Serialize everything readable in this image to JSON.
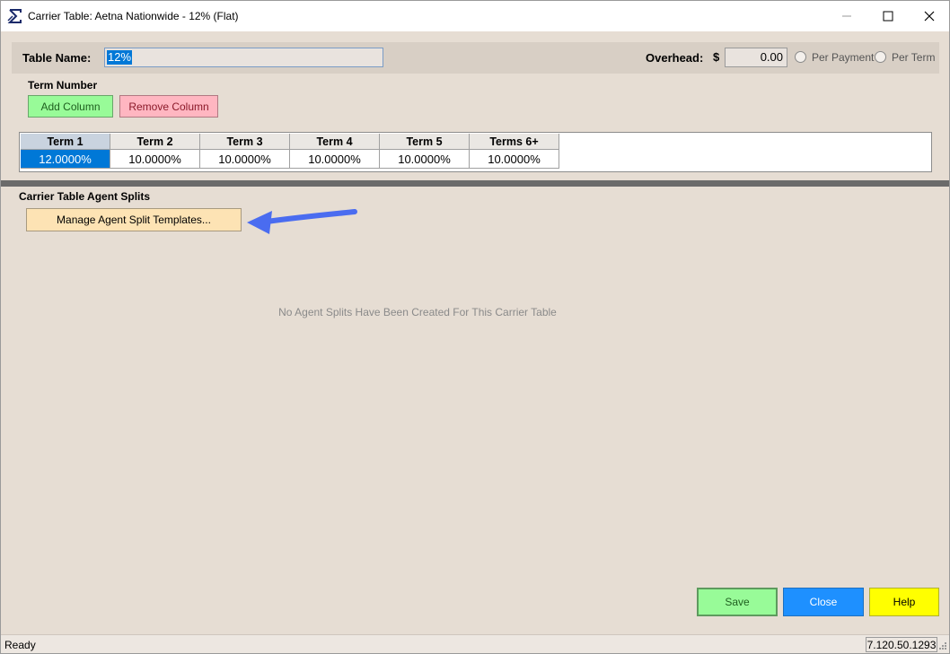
{
  "window": {
    "title": "Carrier Table: Aetna Nationwide - 12% (Flat)",
    "icon": "sigma-icon",
    "controls": {
      "minimize": "minimize-icon",
      "maximize": "maximize-icon",
      "close": "close-icon"
    }
  },
  "header": {
    "table_name_label": "Table Name:",
    "table_name_value": "12%",
    "overhead_label": "Overhead:",
    "currency_symbol": "$",
    "overhead_value": "0.00",
    "radio_per_payment": "Per Payment",
    "radio_per_term": "Per Term"
  },
  "terms": {
    "section_label": "Term Number",
    "add_column": "Add Column",
    "remove_column": "Remove Column",
    "columns": [
      "Term 1",
      "Term 2",
      "Term 3",
      "Term 4",
      "Term 5",
      "Terms 6+"
    ],
    "values": [
      "12.0000%",
      "10.0000%",
      "10.0000%",
      "10.0000%",
      "10.0000%",
      "10.0000%"
    ]
  },
  "splits": {
    "section_label": "Carrier Table Agent Splits",
    "manage_button": "Manage Agent Split Templates...",
    "empty_message": "No Agent Splits Have Been Created For This Carrier Table"
  },
  "footer": {
    "save": "Save",
    "close": "Close",
    "help": "Help"
  },
  "status": {
    "text": "Ready",
    "version": "7.120.50.1293"
  },
  "colors": {
    "window_bg": "#e6ddd3",
    "add_button": "#98fb98",
    "remove_button": "#ffb6c1",
    "manage_button": "#fde3b4",
    "save_button": "#98fb98",
    "close_button": "#1e90ff",
    "help_button": "#ffff00",
    "selection": "#0078d7",
    "arrow": "#4a6cf0"
  }
}
